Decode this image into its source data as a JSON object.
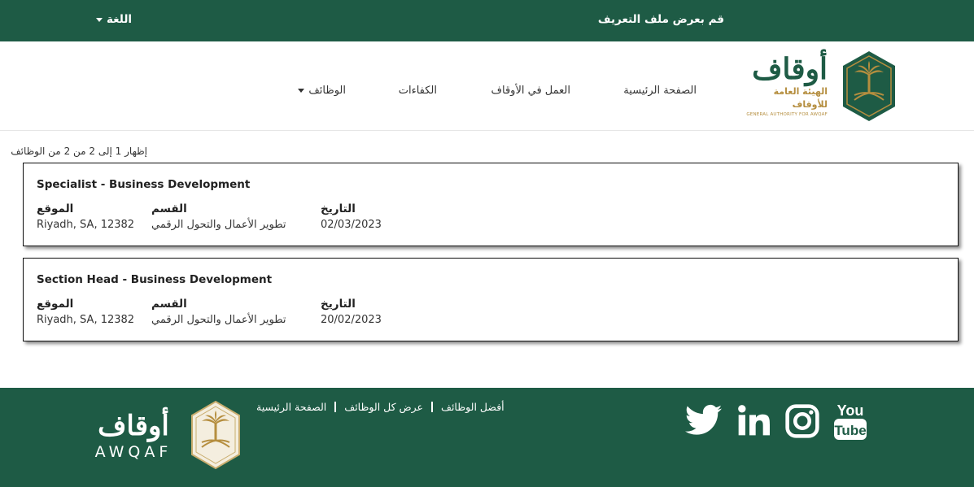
{
  "topbar": {
    "profile_link": "قم بعرض ملف التعريف",
    "language": "اللغة"
  },
  "logo": {
    "name_ar": "أوقاف",
    "subtitle_ar": "الهيئة العامة للأوقاف",
    "subtitle_en": "GENERAL AUTHORITY FOR AWQAF"
  },
  "nav": {
    "home": "الصفحة الرئيسية",
    "work_at": "العمل في الأوقاف",
    "competencies": "الكفاءات",
    "jobs": "الوظائف"
  },
  "results": {
    "count_text": "إظهار 1 إلى 2 من 2 من الوظائف"
  },
  "jobs": [
    {
      "title": "Specialist - Business Development",
      "location_label": "الموقع",
      "location": "Riyadh, SA, 12382",
      "department_label": "القسم",
      "department": "تطوير الأعمال والتحول الرقمي",
      "date_label": "التاريخ",
      "date": "02/03/2023"
    },
    {
      "title": "Section Head - Business Development",
      "location_label": "الموقع",
      "location": "Riyadh, SA, 12382",
      "department_label": "القسم",
      "department": "تطوير الأعمال والتحول الرقمي",
      "date_label": "التاريخ",
      "date": "20/02/2023"
    }
  ],
  "footer": {
    "logo_ar": "أوقاف",
    "logo_en": "AWQAF",
    "links": [
      "أفضل الوظائف",
      "عرض كل الوظائف",
      "الصفحة الرئيسية"
    ],
    "social": [
      "youtube-icon",
      "instagram-icon",
      "linkedin-icon",
      "twitter-icon"
    ]
  },
  "colors": {
    "brand_green": "#1e5b45",
    "brand_gold": "#b58e3f"
  }
}
